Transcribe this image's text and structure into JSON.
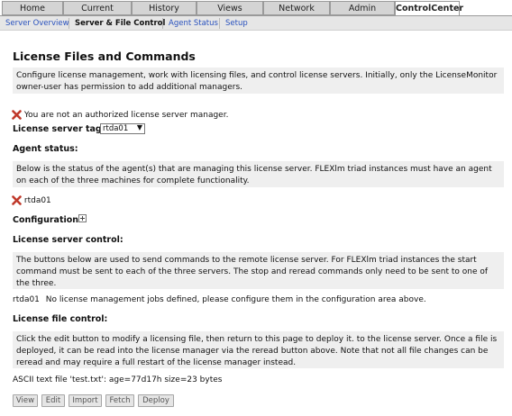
{
  "top_tabs": [
    "Home",
    "Current",
    "History",
    "Views",
    "Network",
    "Admin",
    "ControlCenter"
  ],
  "sub_nav": [
    "Server Overview",
    "Server & File Control",
    "Agent Status",
    "Setup"
  ],
  "page_title": "License Files and Commands",
  "intro_text": "Configure license management, work with licensing files, and control license servers. Initially, only the LicenseMonitor owner-user has permission to add additional managers.",
  "auth_message": "You are not an authorized license server manager.",
  "server_tag": {
    "label": "License server tag:",
    "selected": "rtda01"
  },
  "agent_status": {
    "heading": "Agent status:",
    "description": "Below is the status of the agent(s) that are managing this license server. FLEXlm triad instances must have an agent on each of the three machines for complete functionality.",
    "agent_name": "rtda01"
  },
  "configuration": {
    "label": "Configuration:"
  },
  "server_control": {
    "heading": "License server control:",
    "description": "The buttons below are used to send commands to the remote license server. For FLEXlm triad instances the start command must be sent to each of the three servers. The stop and reread commands only need to be sent to one of the three.",
    "host": "rtda01",
    "jobs_message": "No license management jobs defined, please configure them in the configuration area above."
  },
  "file_control": {
    "heading": "License file control:",
    "description": "Click the edit button to modify a licensing file, then return to this page to deploy it. to the license server. Once a file is deployed, it can be read into the license manager via the reread button above. Note that not all file changes can be reread and may require a full restart of the license manager instead.",
    "file_info": "ASCII text file 'test.txt': age=77d17h size=23 bytes"
  },
  "buttons": {
    "view": "View",
    "edit": "Edit",
    "import": "Import",
    "fetch": "Fetch",
    "deploy": "Deploy"
  },
  "colors": {
    "error_icon": "#c0392b",
    "link": "#2a52be",
    "box_bg": "#efefef"
  }
}
